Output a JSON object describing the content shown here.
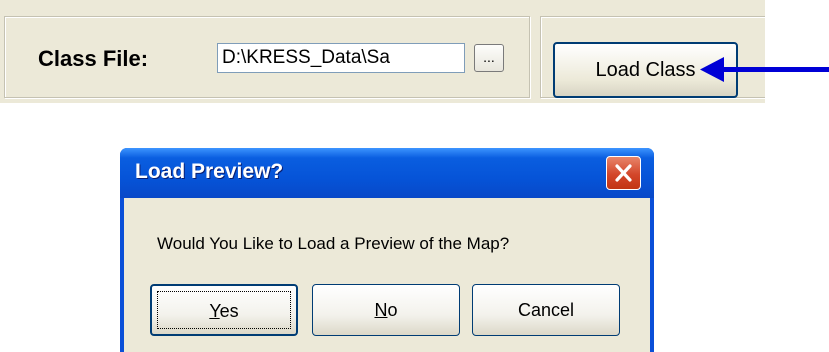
{
  "class_file": {
    "label": "Class File:",
    "value": "D:\\KRESS_Data\\Sa",
    "browse_label": "..."
  },
  "load_class": {
    "label": "Load Class"
  },
  "dialog": {
    "title": "Load Preview?",
    "message": "Would You Like to Load a Preview of the Map?",
    "buttons": {
      "yes_mnemonic": "Y",
      "yes_rest": "es",
      "no_mnemonic": "N",
      "no_rest": "o",
      "cancel": "Cancel"
    }
  },
  "colors": {
    "arrow": "#0000d6",
    "titlebar": "#0654d8",
    "close": "#d3462a"
  }
}
